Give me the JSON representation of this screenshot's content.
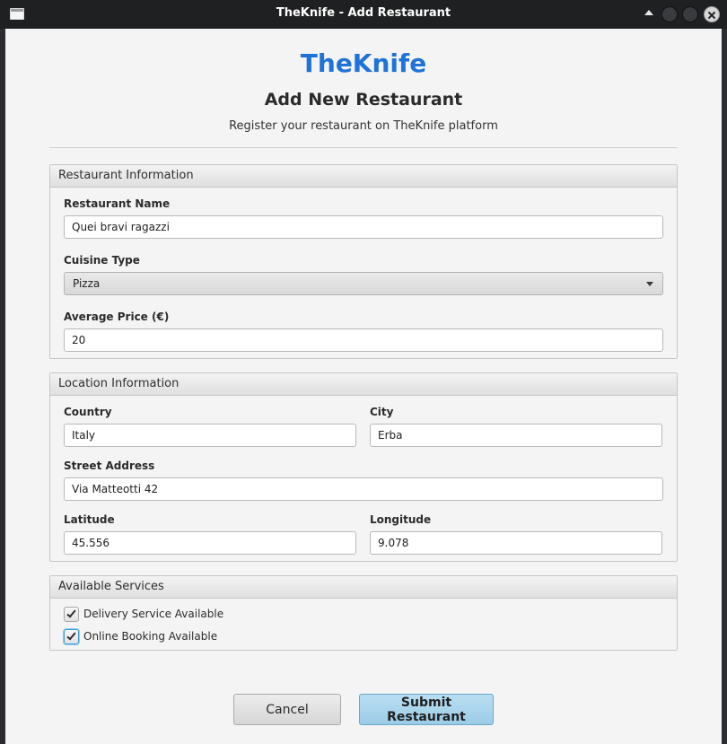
{
  "window": {
    "title": "TheKnife - Add Restaurant"
  },
  "header": {
    "brand": "TheKnife",
    "heading": "Add New Restaurant",
    "subheading": "Register your restaurant on TheKnife platform"
  },
  "restaurant_info": {
    "title": "Restaurant Information",
    "name_label": "Restaurant Name",
    "name_value": "Quei bravi ragazzi",
    "cuisine_label": "Cuisine Type",
    "cuisine_value": "Pizza",
    "price_label": "Average Price (€)",
    "price_value": "20"
  },
  "location_info": {
    "title": "Location Information",
    "country_label": "Country",
    "country_value": "Italy",
    "city_label": "City",
    "city_value": "Erba",
    "street_label": "Street Address",
    "street_value": "Via Matteotti 42",
    "latitude_label": "Latitude",
    "latitude_value": "45.556",
    "longitude_label": "Longitude",
    "longitude_value": "9.078"
  },
  "services": {
    "title": "Available Services",
    "items": [
      {
        "label": "Delivery Service Available",
        "checked": true
      },
      {
        "label": "Online Booking Available",
        "checked": true
      }
    ]
  },
  "actions": {
    "cancel_label": "Cancel",
    "submit_label": "Submit Restaurant"
  },
  "colors": {
    "brand": "#1f73d8",
    "submit_button": "#a9d4ec",
    "focus_ring": "#3c9bd6"
  }
}
